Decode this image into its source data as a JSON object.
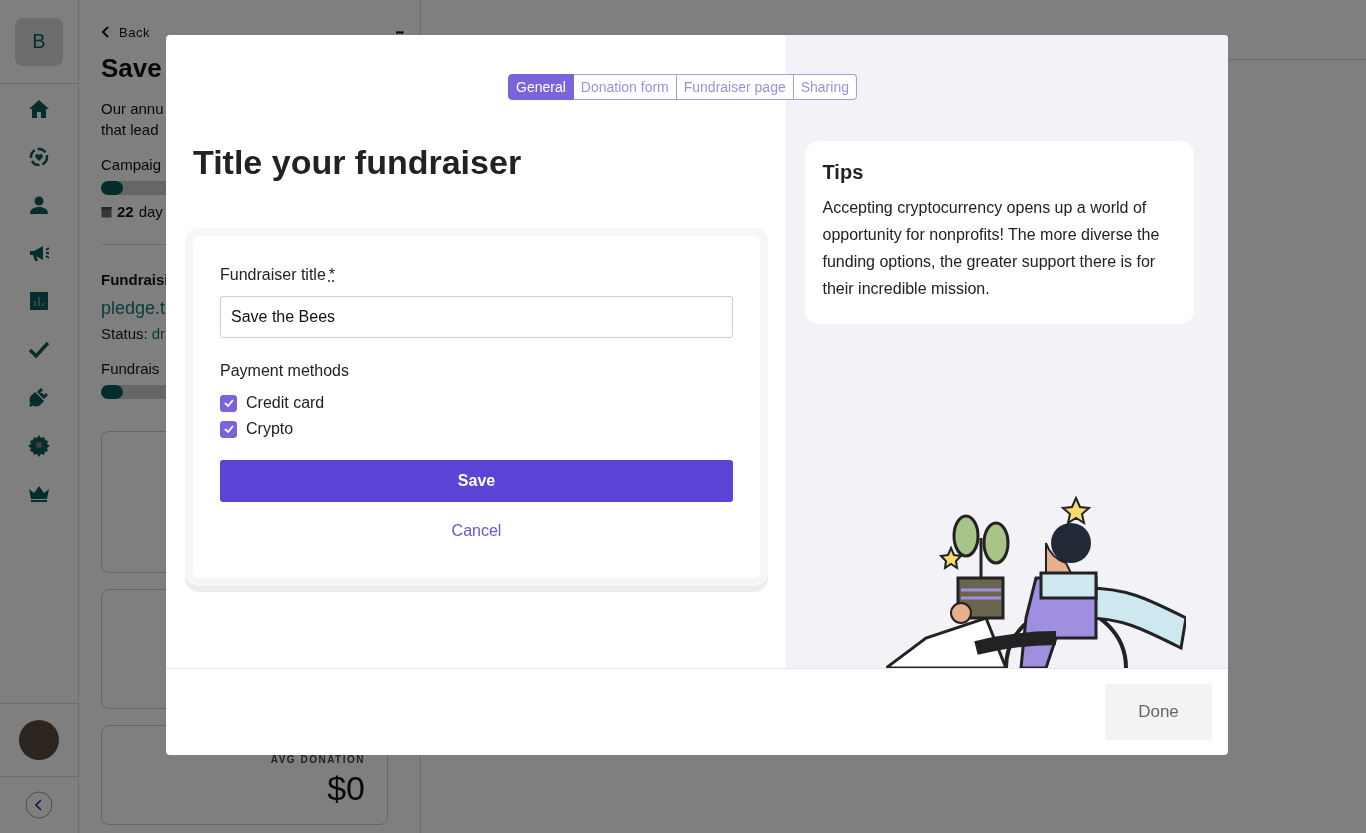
{
  "sidebar": {
    "logo": "B"
  },
  "page": {
    "back": "Back",
    "more": "•••",
    "title": "Save",
    "description": [
      "Our annu",
      "that lead"
    ],
    "campaign_label": "Campaig",
    "campaign_progress": {
      "level": 0.08
    },
    "days_number": "22",
    "days_text": "day",
    "fundraising_label": "Fundraisi",
    "link": "pledge.t",
    "status_label": "Status:",
    "status_value": "dr",
    "fundraising_label_2": "Fundrais",
    "fundraising_progress": {
      "level": 0.08
    },
    "avg_label": "AVG DONATION",
    "avg_value": "$0"
  },
  "modal": {
    "tabs": [
      {
        "label": "General",
        "selected": true
      },
      {
        "label": "Donation form",
        "selected": false
      },
      {
        "label": "Fundraiser page",
        "selected": false
      },
      {
        "label": "Sharing",
        "selected": false
      }
    ],
    "heading": "Title your fundraiser",
    "form": {
      "title_label": "Fundraiser title",
      "required_mark": "*",
      "title_value": "Save the Bees",
      "payment_label": "Payment methods",
      "payment_methods": [
        {
          "label": "Credit card",
          "checked": true
        },
        {
          "label": "Crypto",
          "checked": true
        }
      ],
      "save": "Save",
      "cancel": "Cancel"
    },
    "tips": {
      "title": "Tips",
      "text": "Accepting cryptocurrency opens up a world of opportunity for nonprofits! The more diverse the funding options, the greater support there is for their incredible mission."
    },
    "done": {
      "label": "Done",
      "disabled": true
    }
  }
}
